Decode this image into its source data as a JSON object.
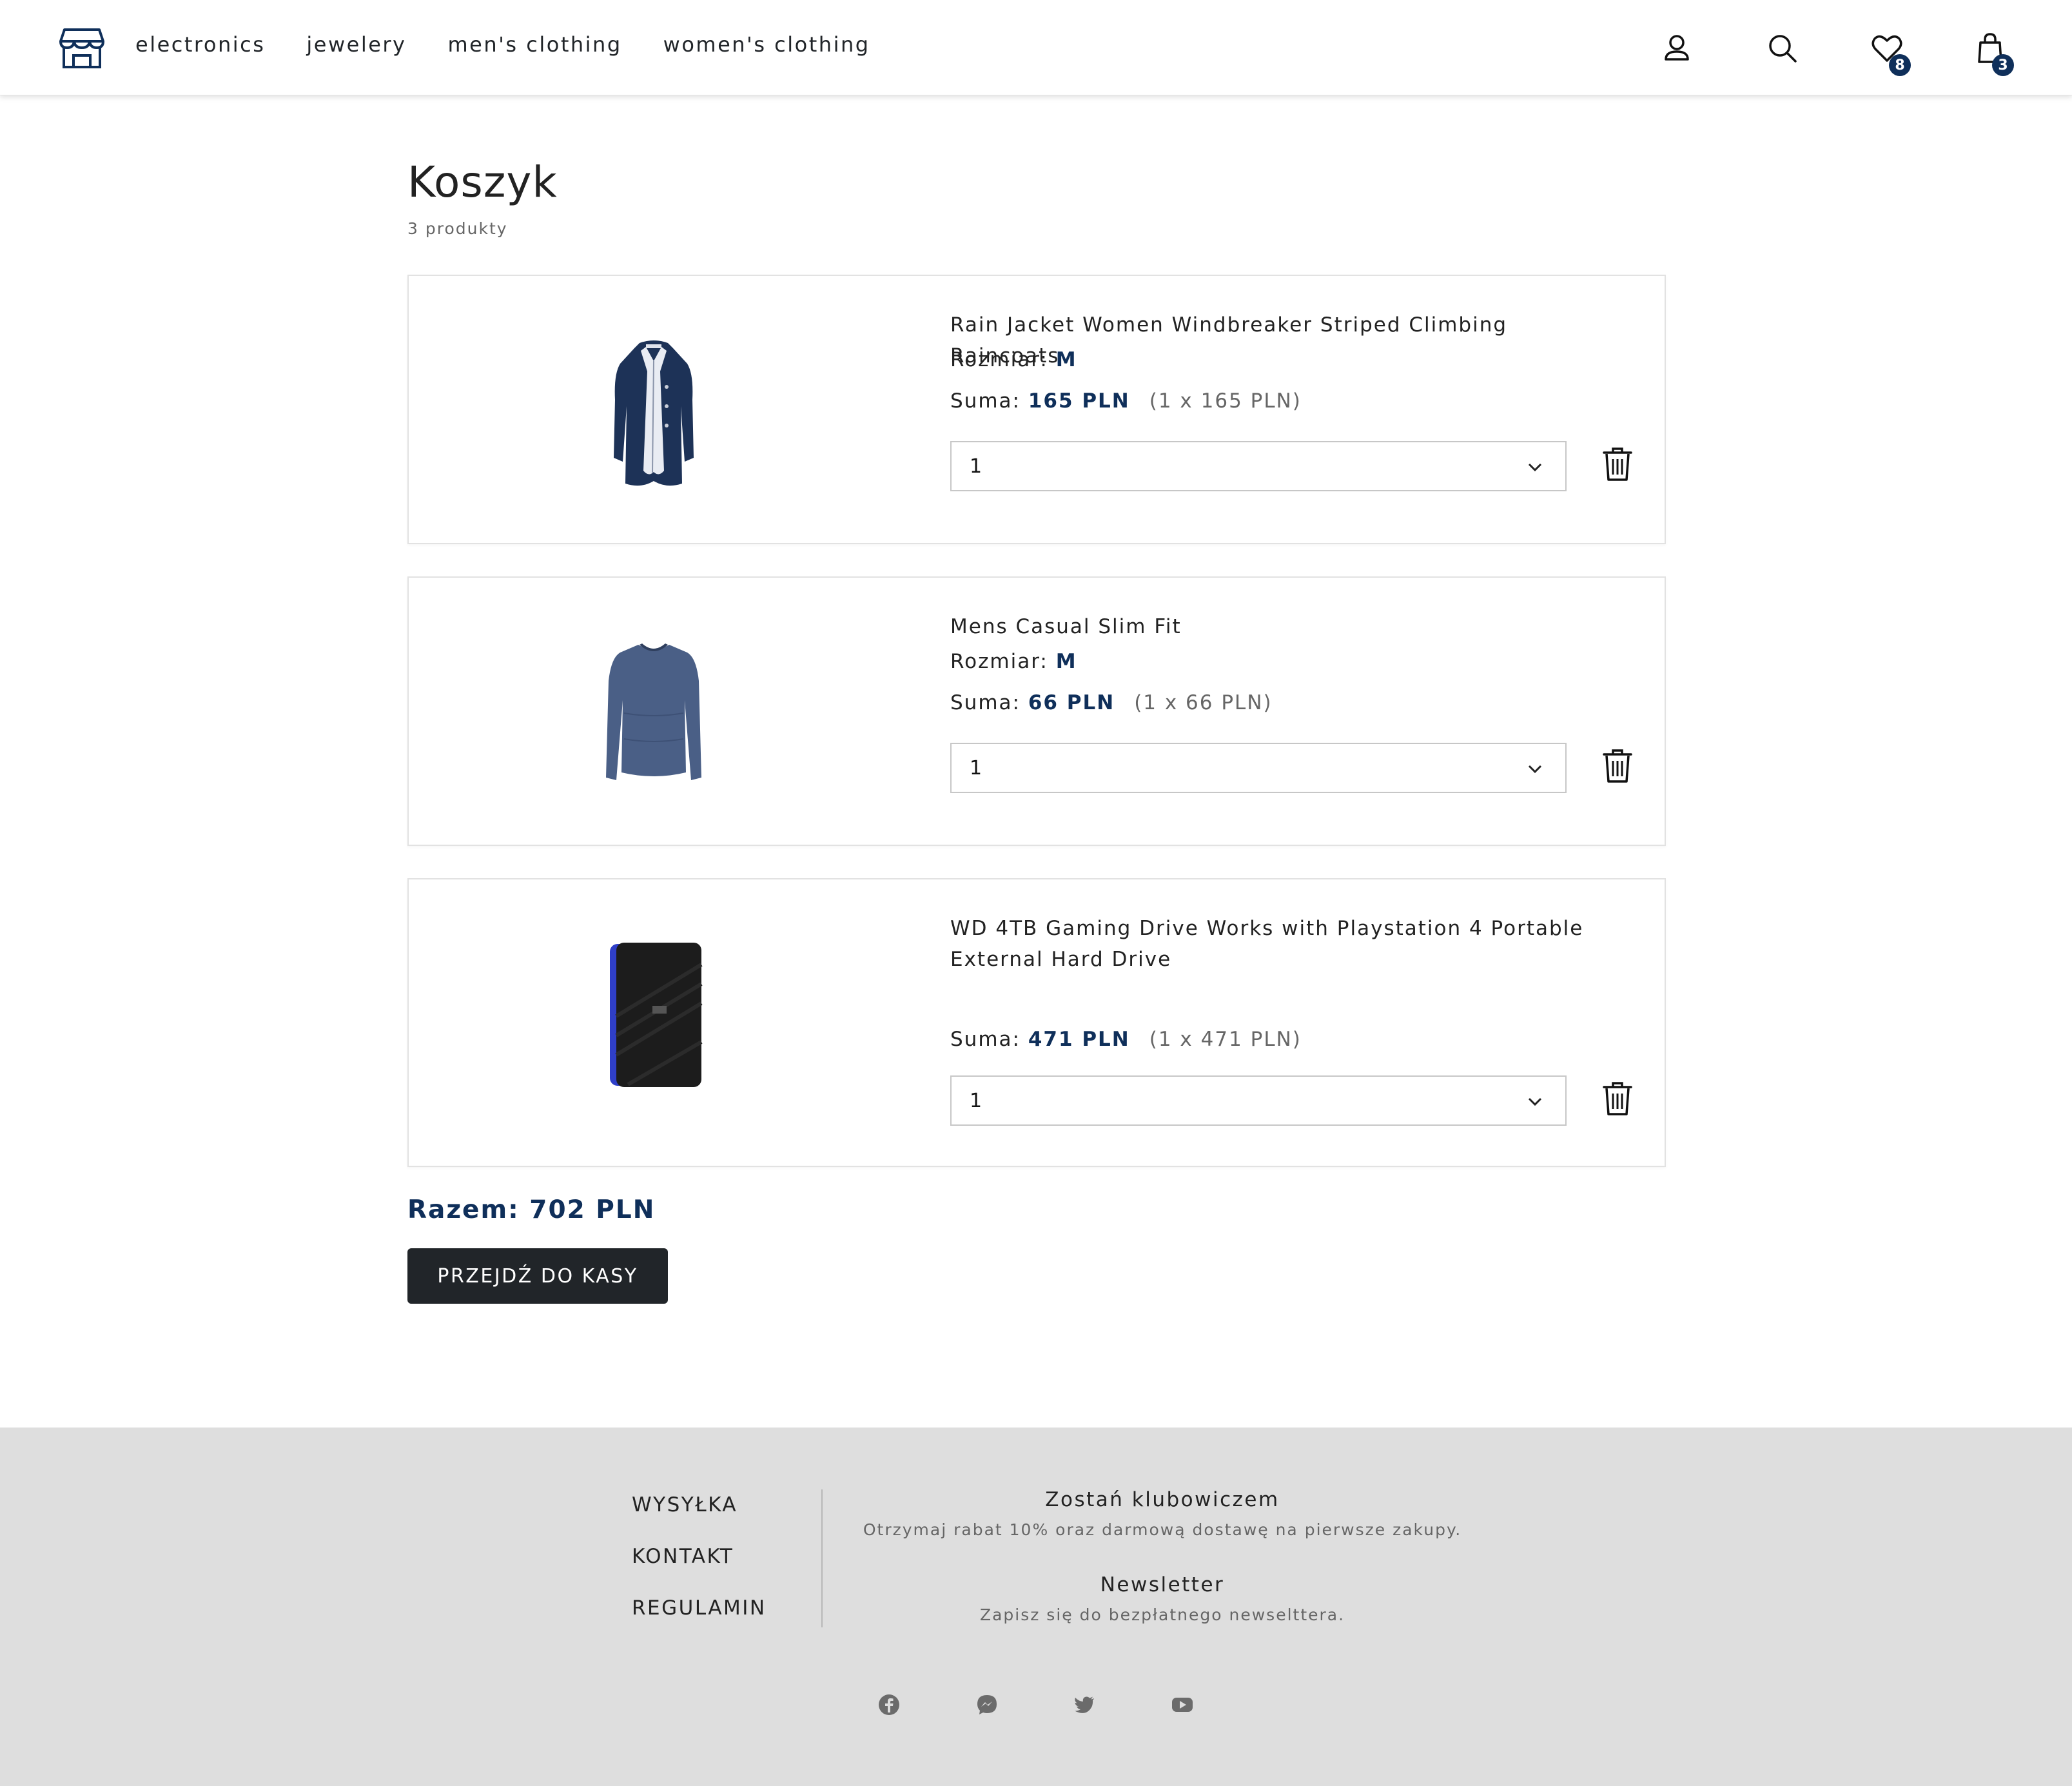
{
  "header": {
    "nav": [
      "electronics",
      "jewelery",
      "men's clothing",
      "women's clothing"
    ],
    "wishlist_count": "8",
    "cart_count": "3",
    "icons": [
      "store-icon",
      "user-icon",
      "search-icon",
      "heart-icon",
      "bag-icon"
    ]
  },
  "cart": {
    "title": "Koszyk",
    "count_label": "3 produkty",
    "items": [
      {
        "name": "Rain Jacket Women Windbreaker Striped Climbing Raincoats",
        "size_label": "Rozmiar:",
        "size": "M",
        "sum_label": "Suma:",
        "sum": "165 PLN",
        "unit": "(1 x 165 PLN)",
        "qty": "1",
        "image": "jacket"
      },
      {
        "name": "Mens Casual Slim Fit",
        "size_label": "Rozmiar:",
        "size": "M",
        "sum_label": "Suma:",
        "sum": "66 PLN",
        "unit": "(1 x 66 PLN)",
        "qty": "1",
        "image": "sweater"
      },
      {
        "name": "WD 4TB Gaming Drive Works with Playstation 4 Portable External Hard Drive",
        "sum_label": "Suma:",
        "sum": "471 PLN",
        "unit": "(1 x 471 PLN)",
        "qty": "1",
        "image": "hard-drive"
      }
    ],
    "total": "Razem: 702 PLN",
    "checkout_label": "PRZEJDŹ DO KASY"
  },
  "footer": {
    "links": [
      "WYSYŁKA",
      "KONTAKT",
      "REGULAMIN"
    ],
    "club_title": "Zostań klubowiczem",
    "club_text": "Otrzymaj rabat 10% oraz darmową dostawę na pierwsze zakupy.",
    "newsletter_title": "Newsletter",
    "newsletter_text": "Zapisz się do bezpłatnego newselttera.",
    "social": [
      "facebook-icon",
      "messenger-icon",
      "twitter-icon",
      "youtube-icon"
    ]
  },
  "colors": {
    "accent": "#0f2f5a",
    "button_dark": "#212529",
    "footer_bg": "#dedede"
  }
}
